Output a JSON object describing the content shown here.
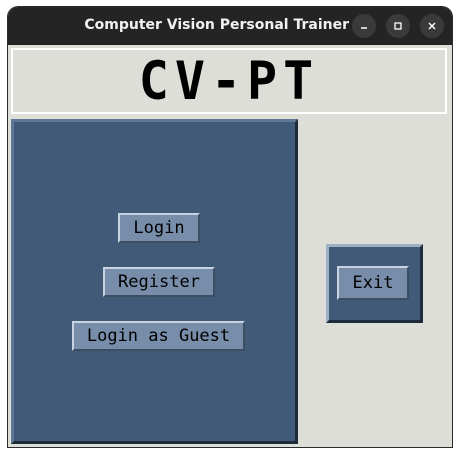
{
  "window": {
    "title": "Computer Vision Personal Trainer",
    "controls": {
      "minimize": "–",
      "maximize": "□",
      "close": "✕"
    }
  },
  "header": {
    "logo_text": "CV-PT"
  },
  "auth_panel": {
    "login_label": "Login",
    "register_label": "Register",
    "guest_label": "Login as Guest"
  },
  "side_panel": {
    "exit_label": "Exit"
  },
  "colors": {
    "titlebar": "#242424",
    "panel_bg": "#415a77",
    "button_bg": "#778da9",
    "window_bg": "#deded8"
  }
}
